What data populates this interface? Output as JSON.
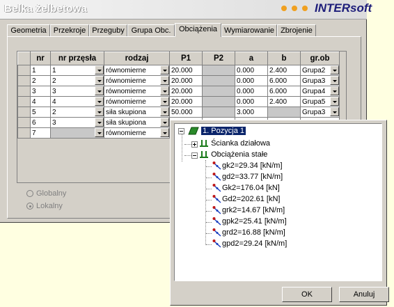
{
  "window": {
    "title": "Belka żelbetowa",
    "brand": "INTERsoft"
  },
  "tabs": [
    "Geometria",
    "Przekroje",
    "Przeguby",
    "Grupa Obc.",
    "Obciążenia",
    "Wymiarowanie",
    "Zbrojenie"
  ],
  "active_tab": "Obciążenia",
  "table": {
    "headers": [
      "nr",
      "nr przęsła",
      "rodzaj",
      "P1",
      "P2",
      "a",
      "b",
      "gr.ob"
    ],
    "rows": [
      {
        "nr": "1",
        "przeslo": "1",
        "rodzaj": "równomierne",
        "p1": "20.000",
        "p2": "",
        "a": "0.000",
        "b": "2.400",
        "grob": "Grupa2"
      },
      {
        "nr": "2",
        "przeslo": "2",
        "rodzaj": "równomierne",
        "p1": "20.000",
        "p2": "",
        "a": "0.000",
        "b": "6.000",
        "grob": "Grupa3"
      },
      {
        "nr": "3",
        "przeslo": "3",
        "rodzaj": "równomierne",
        "p1": "20.000",
        "p2": "",
        "a": "0.000",
        "b": "6.000",
        "grob": "Grupa4"
      },
      {
        "nr": "4",
        "przeslo": "4",
        "rodzaj": "równomierne",
        "p1": "20.000",
        "p2": "",
        "a": "0.000",
        "b": "2.400",
        "grob": "Grupa5"
      },
      {
        "nr": "5",
        "przeslo": "2",
        "rodzaj": "siła skupiona",
        "p1": "50.000",
        "p2": "",
        "a": "3.000",
        "b": "",
        "grob": "Grupa3"
      },
      {
        "nr": "6",
        "przeslo": "3",
        "rodzaj": "siła skupiona",
        "p1": "",
        "p2": "",
        "a": "",
        "b": "",
        "grob": ""
      },
      {
        "nr": "7",
        "przeslo": "",
        "rodzaj": "równomierne",
        "p1": "",
        "p2": "",
        "a": "",
        "b": "",
        "grob": ""
      }
    ]
  },
  "options": {
    "globalny": "Globalny",
    "lokalny": "Lokalny",
    "selected": "Lokalny"
  },
  "tree": {
    "root": "1. Pozycja 1",
    "children": [
      "Ścianka działowa",
      "Obciążenia stałe"
    ],
    "leaves": [
      "gk2=29.34 [kN/m]",
      "gd2=33.77 [kN/m]",
      "Gk2=176.04 [kN]",
      "Gd2=202.61 [kN]",
      "grk2=14.67 [kN/m]",
      "gpk2=25.41 [kN/m]",
      "grd2=16.88 [kN/m]",
      "gpd2=29.24 [kN/m]"
    ]
  },
  "buttons": {
    "ok": "OK",
    "cancel": "Anuluj"
  },
  "colors": {
    "selection": "#0a246a",
    "brand": "#1d1d7a",
    "dots": "#f0a020"
  }
}
